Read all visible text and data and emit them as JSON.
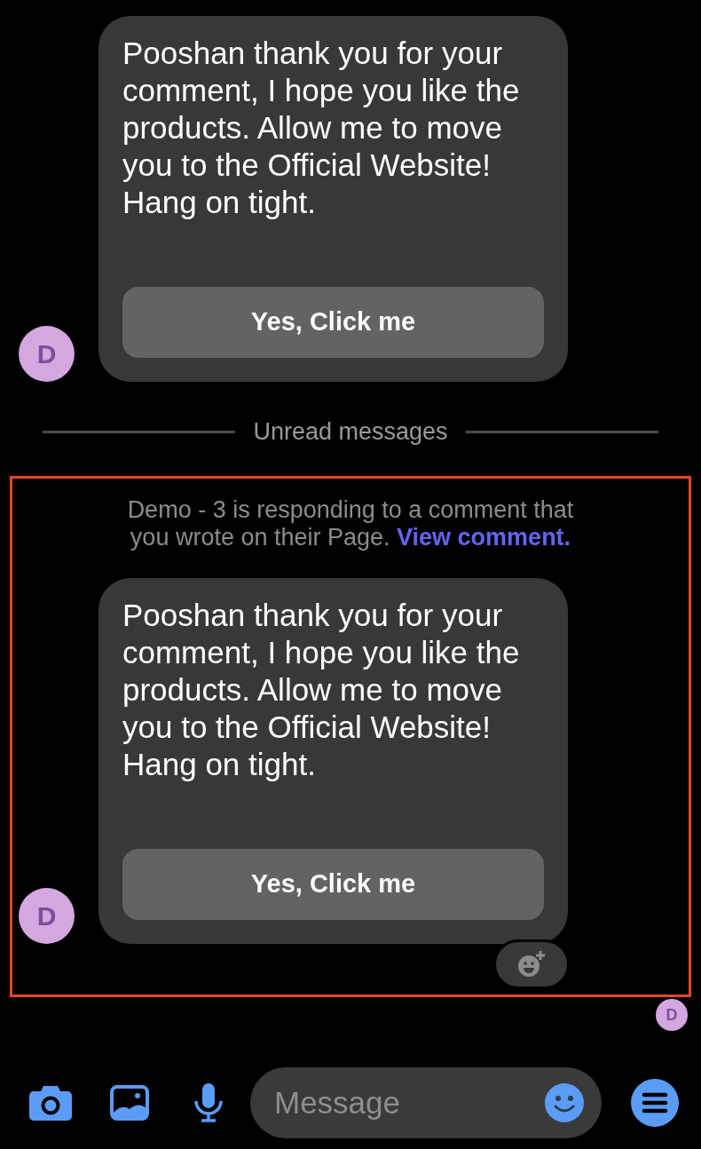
{
  "thread": [
    {
      "kind": "message",
      "highlighted": false,
      "avatar": "D",
      "text": "Pooshan thank you for your comment, I hope you like the products. Allow me to move you to the Official Website! Hang on tight.",
      "button": "Yes, Click me",
      "reaction_button": false
    },
    {
      "kind": "divider",
      "label": "Unread messages"
    },
    {
      "kind": "message",
      "highlighted": true,
      "notice": "Demo - 3 is responding to a comment that you wrote on their Page.",
      "notice_link": "View comment.",
      "avatar": "D",
      "text": "Pooshan thank you for your comment, I hope you like the products. Allow me to move you to the Official Website! Hang on tight.",
      "button": "Yes, Click me",
      "reaction_button": true
    }
  ],
  "seen_avatar": "D",
  "composer": {
    "placeholder": "Message"
  }
}
